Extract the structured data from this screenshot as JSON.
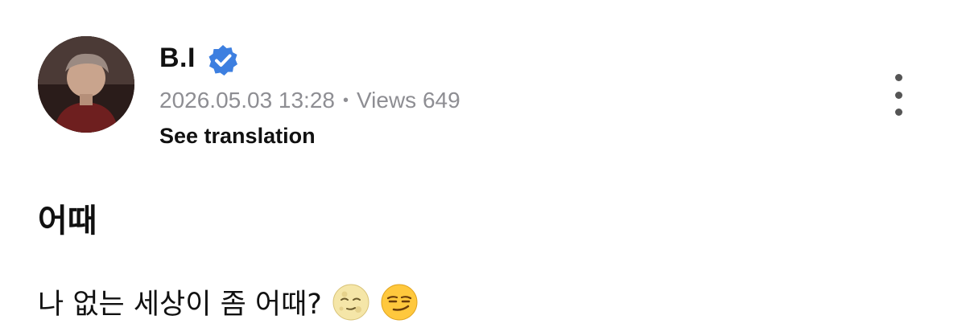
{
  "author": {
    "name": "B.I",
    "verified_icon": "verified-check-badge-icon",
    "avatar_icon": "profile-photo"
  },
  "meta": {
    "timestamp": "2026.05.03 13:28",
    "separator": "•",
    "views": "Views 649"
  },
  "actions": {
    "translate_label": "See translation",
    "more_icon": "vertical-ellipsis-icon"
  },
  "post": {
    "title": "어때",
    "body": "나 없는 세상이 좀 어때?",
    "emojis": [
      "full-moon-face-icon",
      "smirking-face-icon"
    ]
  },
  "colors": {
    "badge_blue": "#3d7fe0",
    "meta_gray": "#8e8e93",
    "text": "#111111"
  }
}
